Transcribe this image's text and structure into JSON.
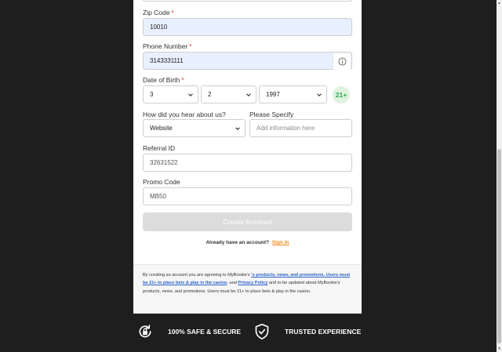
{
  "form": {
    "zip": {
      "label": "Zip Code",
      "required": "*",
      "value": "10010"
    },
    "phone": {
      "label": "Phone Number",
      "required": "*",
      "value": "3143331111",
      "icon": "info-icon"
    },
    "dob": {
      "label": "Date of Birth",
      "required": "*",
      "month": "3",
      "day": "2",
      "year": "1997",
      "age_badge": "21+"
    },
    "hear_about": {
      "label": "How did you hear about us?",
      "value": "Website"
    },
    "specify": {
      "label": "Please Specify",
      "placeholder": "Add information here"
    },
    "referral": {
      "label": "Referral ID",
      "value": "32631522"
    },
    "promo": {
      "label": "Promo Code",
      "value": "MB50"
    },
    "create_button": "Create Account",
    "signin_prompt": "Already have an account?",
    "signin_link": "Sign In"
  },
  "legal": {
    "part1": "By creating an account you are agreeing to MyBookie's ",
    "link1": "'s products, news, and promotions. Users must be 21+ to place bets & play in the casino",
    "part2": ", and ",
    "link2": "Privacy Policy",
    "part3": " and to be updated about MyBookie's products, news, and promotions. Users must be 21+ to place bets & play in the casino."
  },
  "footer": {
    "safe": {
      "label": "100% SAFE & SECURE",
      "icon": "lock-rotate-icon"
    },
    "trusted": {
      "label": "TRUSTED EXPERIENCE",
      "icon": "shield-check-icon"
    }
  },
  "colors": {
    "background": "#1e1e1e",
    "autofill": "#e8f0fe",
    "required": "#e0383a",
    "link_orange": "#ef8a1c",
    "link_blue": "#2a62c9",
    "badge_green": "#2fa84f"
  }
}
